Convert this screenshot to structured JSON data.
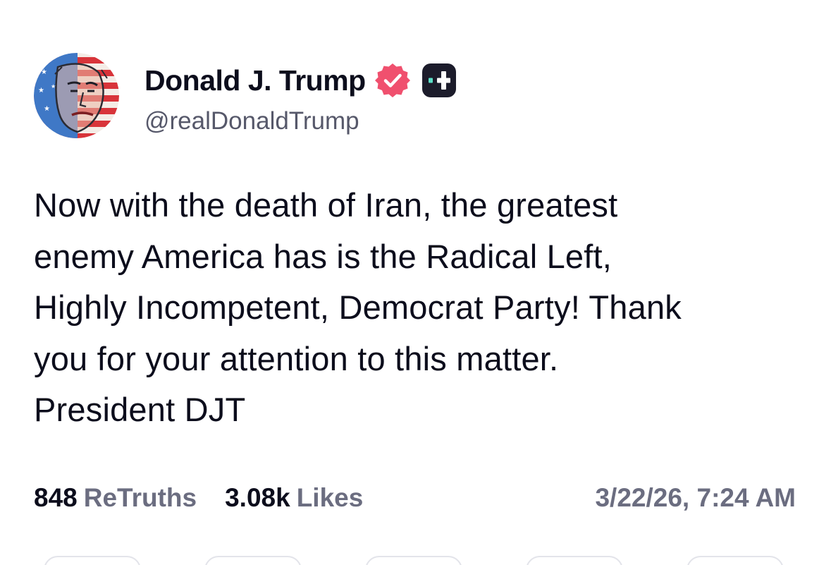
{
  "author": {
    "display_name": "Donald J. Trump",
    "handle": "@realDonaldTrump",
    "avatar_icon": "avatar-image",
    "verified_icon": "verified-badge-icon",
    "verified_color": "#f0506e",
    "plus_icon": "plus-badge-icon",
    "plus_color": "#1c1c2b",
    "plus_accent": "#5ce0c8"
  },
  "post": {
    "text": "Now with the death of Iran, the greatest\nenemy America has is the Radical Left,\nHighly Incompetent, Democrat Party! Thank\nyou for your attention to this matter.\nPresident DJT"
  },
  "stats": {
    "retruths_count": "848",
    "retruths_label": "ReTruths",
    "likes_count": "3.08k",
    "likes_label": "Likes",
    "timestamp": "3/22/26, 7:24 AM"
  }
}
